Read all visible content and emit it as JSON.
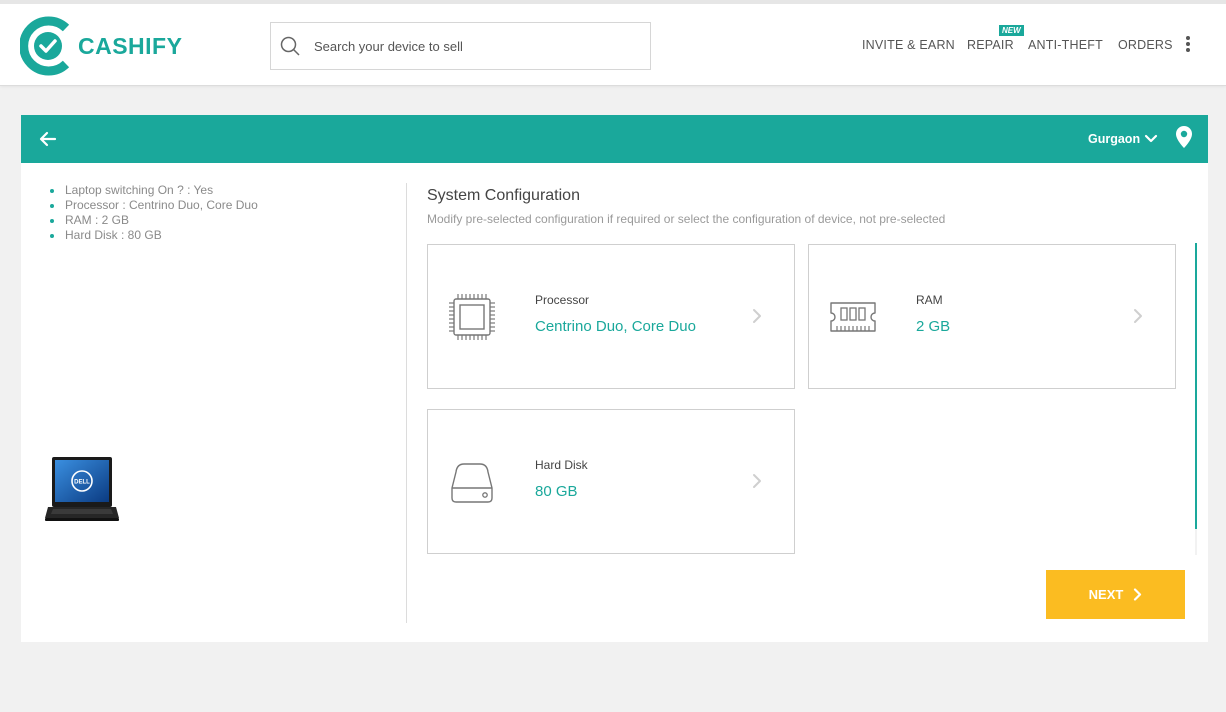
{
  "header": {
    "brand": "CASHIFY",
    "search": {
      "placeholder": "Search your device to sell",
      "value": ""
    },
    "nav": [
      {
        "label": "INVITE & EARN"
      },
      {
        "label": "REPAIR",
        "badge": "NEW"
      },
      {
        "label": "ANTI-THEFT"
      },
      {
        "label": "ORDERS"
      }
    ],
    "menu_icon": "kebab-menu-icon"
  },
  "location_bar": {
    "back_icon": "arrow-left-icon",
    "city": "Gurgaon",
    "dropdown_icon": "chevron-down-icon",
    "location_icon": "map-pin-icon"
  },
  "device_summary": {
    "specs": [
      "Laptop switching On ? : Yes",
      "Processor : Centrino Duo, Core Duo",
      "RAM : 2 GB",
      "Hard Disk : 80 GB"
    ],
    "image": "dell-laptop-image"
  },
  "configuration": {
    "title": "System Configuration",
    "subtitle": "Modify pre-selected configuration if required or select the configuration of device, not pre-selected",
    "cards": [
      {
        "label": "Processor",
        "value": "Centrino Duo, Core Duo",
        "icon": "cpu-chip-icon"
      },
      {
        "label": "RAM",
        "value": "2 GB",
        "icon": "ram-module-icon"
      },
      {
        "label": "Hard Disk",
        "value": "80 GB",
        "icon": "hard-disk-icon"
      }
    ]
  },
  "next_button": {
    "label": "NEXT"
  },
  "colors": {
    "brand": "#1aa89b",
    "next_button": "#fbbc21",
    "background": "#f1f1f1"
  }
}
